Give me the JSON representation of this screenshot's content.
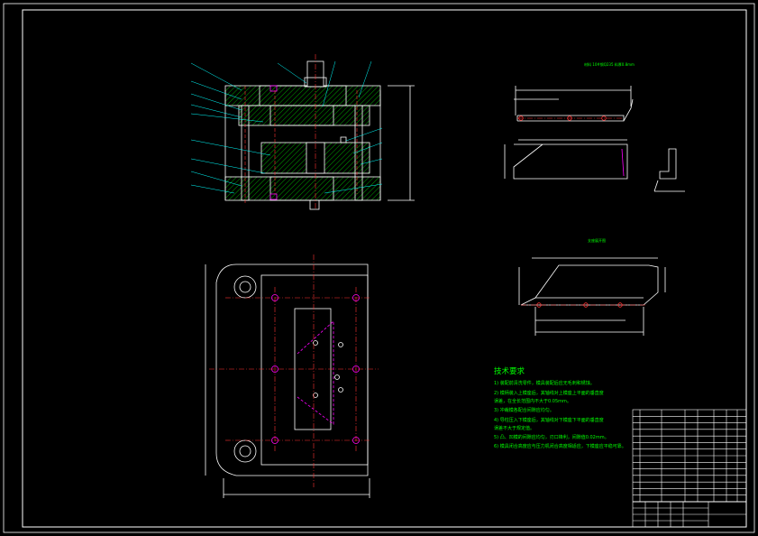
{
  "drawing": {
    "view_titles": {
      "blank_view": "材料 10#钢Q235 料厚0.8mm",
      "part_view": "支座展开图"
    },
    "technical_requirements": {
      "title": "技术要求",
      "items": [
        "1) 装配前清洗零件，模具装配后应无毛刺和锈蚀。",
        "2) 模柄装入上模座后，其轴线对上模座上平面的垂直度",
        "   误差，在全长范围内不大于0.05mm。",
        "3) 冲裁模各配合间隙应均匀。",
        "4) 导柱压入下模座后，其轴线对下模座下平面的垂直度",
        "   误差不大于规定值。",
        "5) 凸、凹模的间隙应均匀，刃口锋利，间隙值0.02mm。",
        "6) 模具闭合高度应与压力机闭合高度相适应，下模座应平稳可靠。"
      ]
    },
    "colors": {
      "background": "#000000",
      "line": "#ffffff",
      "text": "#00ff00",
      "center": "#ff3333",
      "hidden": "#ff00ff",
      "leader": "#00ffff",
      "hatch": "#00cc00",
      "table_text": "#ffff00"
    }
  }
}
